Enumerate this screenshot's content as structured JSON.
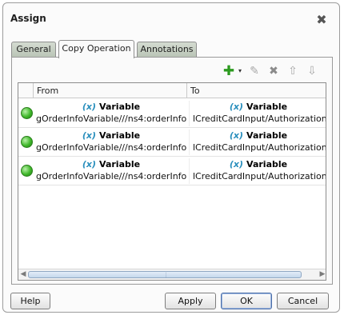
{
  "dialog": {
    "title": "Assign",
    "close_icon": "close-icon"
  },
  "tabs": [
    {
      "label": "General",
      "active": false
    },
    {
      "label": "Copy Operation",
      "active": true
    },
    {
      "label": "Annotations",
      "active": false
    }
  ],
  "toolbar": {
    "add_icon": "plus-icon",
    "dropdown_icon": "chevron-down-icon",
    "edit_icon": "pencil-icon",
    "delete_icon": "x-icon",
    "up_icon": "arrow-up-icon",
    "down_icon": "arrow-down-icon"
  },
  "table": {
    "columns": [
      "From",
      "To"
    ],
    "rows": [
      {
        "status": "valid",
        "from_tag": "(x)",
        "from_type": "Variable",
        "from_path": "gOrderInfoVariable///ns4:orderInfo...",
        "to_tag": "(x)",
        "to_type": "Variable",
        "to_path": "lCreditCardInput/Authorization//ns"
      },
      {
        "status": "valid",
        "from_tag": "(x)",
        "from_type": "Variable",
        "from_path": "gOrderInfoVariable///ns4:orderInfo...",
        "to_tag": "(x)",
        "to_type": "Variable",
        "to_path": "lCreditCardInput/Authorization//ns"
      },
      {
        "status": "valid",
        "from_tag": "(x)",
        "from_type": "Variable",
        "from_path": "gOrderInfoVariable///ns4:orderInfo...",
        "to_tag": "(x)",
        "to_type": "Variable",
        "to_path": "lCreditCardInput/Authorization//ns"
      }
    ]
  },
  "buttons": {
    "help": "Help",
    "apply": "Apply",
    "ok": "OK",
    "cancel": "Cancel"
  },
  "colors": {
    "status_ok": "#40b82b",
    "variable_tag": "#2a8fbd",
    "add": "#2c9a1f"
  }
}
